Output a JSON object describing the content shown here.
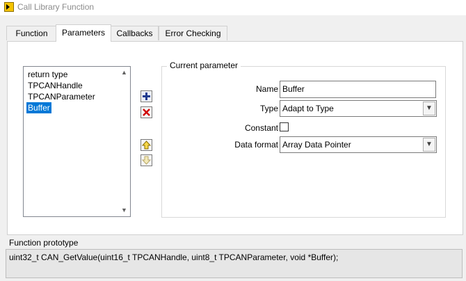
{
  "window": {
    "title": "Call Library Function"
  },
  "tabs": [
    {
      "label": "Function",
      "active": false
    },
    {
      "label": "Parameters",
      "active": true
    },
    {
      "label": "Callbacks",
      "active": false
    },
    {
      "label": "Error Checking",
      "active": false
    }
  ],
  "parameter_list": {
    "items": [
      "return type",
      "TPCANHandle",
      "TPCANParameter",
      "Buffer"
    ],
    "selected": "Buffer"
  },
  "buttons": {
    "add_icon": "plus-icon",
    "delete_icon": "x-icon",
    "move_up_icon": "arrow-up-icon",
    "move_down_icon": "arrow-down-icon"
  },
  "current_parameter": {
    "group_title": "Current parameter",
    "name_label": "Name",
    "name_value": "Buffer",
    "type_label": "Type",
    "type_value": "Adapt to Type",
    "constant_label": "Constant",
    "constant_checked": false,
    "data_format_label": "Data format",
    "data_format_value": "Array Data Pointer"
  },
  "function_prototype": {
    "label": "Function prototype",
    "text": "uint32_t CAN_GetValue(uint16_t TPCANHandle, uint8_t TPCANParameter, void *Buffer);"
  },
  "colors": {
    "selection": "#0078d7",
    "add_button": "#1f3b8f",
    "delete_button": "#d00000",
    "arrow_up": "#d4a000"
  }
}
